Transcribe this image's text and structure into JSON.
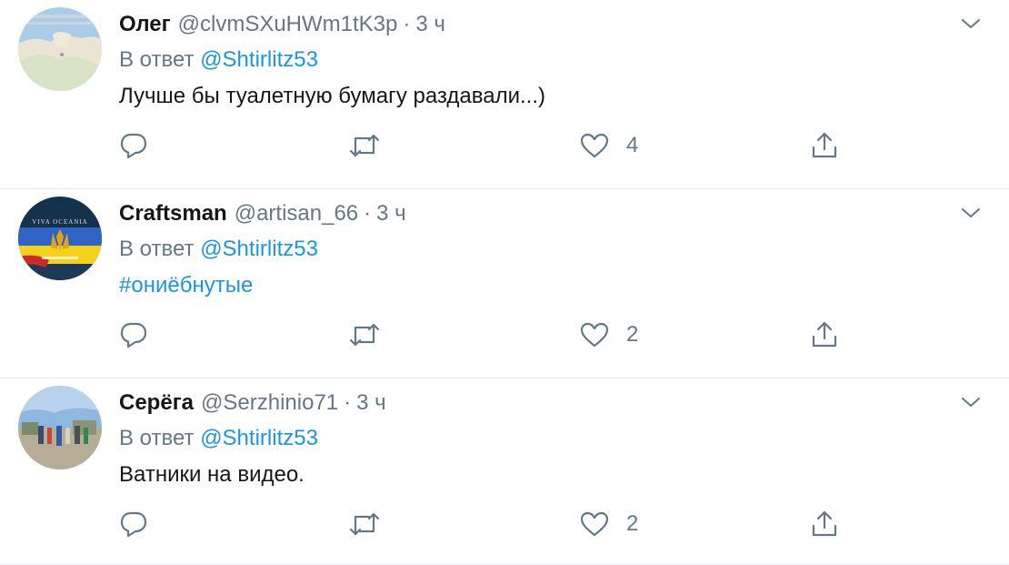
{
  "tweets": [
    {
      "name": "Олег",
      "handle": "@clvmSXuHWm1tK3p",
      "separator": "·",
      "time": "3 ч",
      "reply_prefix": "В ответ",
      "reply_to": "@Shtirlitz53",
      "text": "Лучше бы туалетную бумагу раздавали...)",
      "likes": "4",
      "avatar_icon": "map-avatar"
    },
    {
      "name": "Craftsman",
      "handle": "@artisan_66",
      "separator": "·",
      "time": "3 ч",
      "reply_prefix": "В ответ",
      "reply_to": "@Shtirlitz53",
      "text": "#ониёбнутые",
      "likes": "2",
      "avatar_icon": "flag-avatar",
      "avatar_caption": "VIVA OCEANIA"
    },
    {
      "name": "Серёга",
      "handle": "@Serzhinio71",
      "separator": "·",
      "time": "3 ч",
      "reply_prefix": "В ответ",
      "reply_to": "@Shtirlitz53",
      "text": "Ватники на видео.",
      "likes": "2",
      "avatar_icon": "crowd-photo-avatar"
    }
  ],
  "icons": {
    "reply": "reply-icon",
    "retweet": "retweet-icon",
    "like": "heart-icon",
    "share": "share-icon",
    "menu": "chevron-down-icon"
  },
  "colors": {
    "link": "#1b95e0",
    "secondary": "#657786",
    "text": "#14171a",
    "divider": "#e6ecf0"
  }
}
